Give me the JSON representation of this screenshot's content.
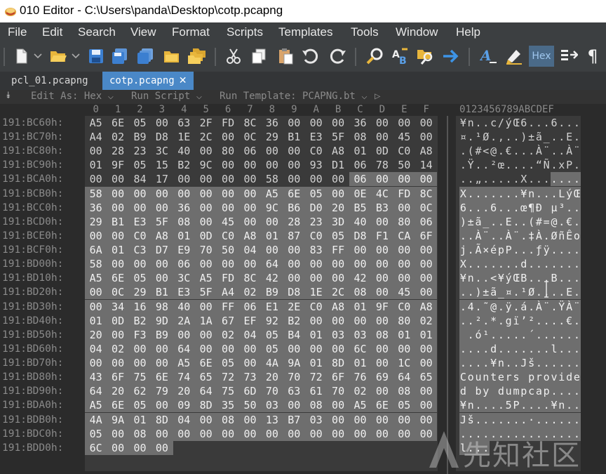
{
  "window": {
    "title": "010 Editor - C:\\Users\\panda\\Desktop\\cotp.pcapng"
  },
  "menu": [
    "File",
    "Edit",
    "Search",
    "View",
    "Format",
    "Scripts",
    "Templates",
    "Tools",
    "Window",
    "Help"
  ],
  "toolbar": {
    "icons": [
      "new-file-icon",
      "open-folder-icon",
      "save-icon",
      "save-as-icon",
      "save-all-icon",
      "close-folder-icon",
      "open-multiple-icon",
      "cut-icon",
      "copy-icon",
      "paste-icon",
      "undo-icon",
      "redo-icon",
      "find-icon",
      "replace-icon",
      "find-in-files-icon",
      "goto-icon",
      "font-icon",
      "highlight-icon",
      "hex-mode-icon",
      "compare-icon",
      "pilcrow-icon"
    ],
    "hex_label": "Hex",
    "pilcrow": "¶"
  },
  "tabs": [
    {
      "label": "pcl_01.pcapng",
      "active": false
    },
    {
      "label": "cotp.pcapng",
      "active": true,
      "close": "✕"
    }
  ],
  "editbar": {
    "edit_as": "Edit As: Hex ⌵",
    "run_script": "Run Script ⌵",
    "run_template": "Run Template: PCAPNG.bt ⌵",
    "play": "▷"
  },
  "hex": {
    "column_headers": [
      "0",
      "1",
      "2",
      "3",
      "4",
      "5",
      "6",
      "7",
      "8",
      "9",
      "A",
      "B",
      "C",
      "D",
      "E",
      "F"
    ],
    "ascii_header": "0123456789ABCDEF",
    "selection_color": "#6e6e6e",
    "rows": [
      {
        "addr": "191:BC60h:",
        "bytes": [
          "A5",
          "6E",
          "05",
          "00",
          "63",
          "2F",
          "FD",
          "8C",
          "36",
          "00",
          "00",
          "00",
          "36",
          "00",
          "00",
          "00"
        ],
        "ascii": "¥n..c/ýŒ6...6..."
      },
      {
        "addr": "191:BC70h:",
        "bytes": [
          "A4",
          "02",
          "B9",
          "D8",
          "1E",
          "2C",
          "00",
          "0C",
          "29",
          "B1",
          "E3",
          "5F",
          "08",
          "00",
          "45",
          "00"
        ],
        "ascii": "¤.¹Ø.,..)±ã_..E."
      },
      {
        "addr": "191:BC80h:",
        "bytes": [
          "00",
          "28",
          "23",
          "3C",
          "40",
          "00",
          "80",
          "06",
          "00",
          "00",
          "C0",
          "A8",
          "01",
          "0D",
          "C0",
          "A8"
        ],
        "ascii": ".(#<@.€...À¨..À¨"
      },
      {
        "addr": "191:BC90h:",
        "bytes": [
          "01",
          "9F",
          "05",
          "15",
          "B2",
          "9C",
          "00",
          "00",
          "00",
          "00",
          "93",
          "D1",
          "06",
          "78",
          "50",
          "14"
        ],
        "ascii": ".Ÿ..²œ....“Ñ.xP."
      },
      {
        "addr": "191:BCA0h:",
        "bytes": [
          "00",
          "00",
          "84",
          "17",
          "00",
          "00",
          "00",
          "00",
          "58",
          "00",
          "00",
          "00",
          "06",
          "00",
          "00",
          "00"
        ],
        "ascii": "..„.....X......."
      },
      {
        "addr": "191:BCB0h:",
        "bytes": [
          "58",
          "00",
          "00",
          "00",
          "00",
          "00",
          "00",
          "00",
          "A5",
          "6E",
          "05",
          "00",
          "0E",
          "4C",
          "FD",
          "8C"
        ],
        "ascii": "X.......¥n...LýŒ"
      },
      {
        "addr": "191:BCC0h:",
        "bytes": [
          "36",
          "00",
          "00",
          "00",
          "36",
          "00",
          "00",
          "00",
          "9C",
          "B6",
          "D0",
          "20",
          "B5",
          "B3",
          "00",
          "0C"
        ],
        "ascii": "6...6...œ¶Ð µ³.."
      },
      {
        "addr": "191:BCD0h:",
        "bytes": [
          "29",
          "B1",
          "E3",
          "5F",
          "08",
          "00",
          "45",
          "00",
          "00",
          "28",
          "23",
          "3D",
          "40",
          "00",
          "80",
          "06"
        ],
        "ascii": ")±ã_..E..(#=@.€."
      },
      {
        "addr": "191:BCE0h:",
        "bytes": [
          "00",
          "00",
          "C0",
          "A8",
          "01",
          "0D",
          "C0",
          "A8",
          "01",
          "87",
          "C0",
          "05",
          "D8",
          "F1",
          "CA",
          "6F"
        ],
        "ascii": "..À¨..À¨.‡À.ØñÊo"
      },
      {
        "addr": "191:BCF0h:",
        "bytes": [
          "6A",
          "01",
          "C3",
          "D7",
          "E9",
          "70",
          "50",
          "04",
          "00",
          "00",
          "83",
          "FF",
          "00",
          "00",
          "00",
          "00"
        ],
        "ascii": "j.Ã×épP...ƒÿ...."
      },
      {
        "addr": "191:BD00h:",
        "bytes": [
          "58",
          "00",
          "00",
          "00",
          "06",
          "00",
          "00",
          "00",
          "64",
          "00",
          "00",
          "00",
          "00",
          "00",
          "00",
          "00"
        ],
        "ascii": "X.......d......."
      },
      {
        "addr": "191:BD10h:",
        "bytes": [
          "A5",
          "6E",
          "05",
          "00",
          "3C",
          "A5",
          "FD",
          "8C",
          "42",
          "00",
          "00",
          "00",
          "42",
          "00",
          "00",
          "00"
        ],
        "ascii": "¥n..<¥ýŒB...B..."
      },
      {
        "addr": "191:BD20h:",
        "bytes": [
          "00",
          "0C",
          "29",
          "B1",
          "E3",
          "5F",
          "A4",
          "02",
          "B9",
          "D8",
          "1E",
          "2C",
          "08",
          "00",
          "45",
          "00"
        ],
        "ascii": "..)±ã_¤.¹Ø.,..E."
      },
      {
        "addr": "191:BD30h:",
        "bytes": [
          "00",
          "34",
          "16",
          "98",
          "40",
          "00",
          "FF",
          "06",
          "E1",
          "2E",
          "C0",
          "A8",
          "01",
          "9F",
          "C0",
          "A8"
        ],
        "ascii": ".4.˜@.ÿ.á.À¨.ŸÀ¨"
      },
      {
        "addr": "191:BD40h:",
        "bytes": [
          "01",
          "0D",
          "B2",
          "9D",
          "2A",
          "1A",
          "67",
          "EF",
          "92",
          "B2",
          "00",
          "00",
          "00",
          "00",
          "80",
          "02"
        ],
        "ascii": "..².*.gï’²....€."
      },
      {
        "addr": "191:BD50h:",
        "bytes": [
          "20",
          "00",
          "F3",
          "B9",
          "00",
          "00",
          "02",
          "04",
          "05",
          "B4",
          "01",
          "03",
          "03",
          "08",
          "01",
          "01"
        ],
        "ascii": " .ó¹.....´......"
      },
      {
        "addr": "191:BD60h:",
        "bytes": [
          "04",
          "02",
          "00",
          "00",
          "64",
          "00",
          "00",
          "00",
          "05",
          "00",
          "00",
          "00",
          "6C",
          "00",
          "00",
          "00"
        ],
        "ascii": "....d.......l..."
      },
      {
        "addr": "191:BD70h:",
        "bytes": [
          "00",
          "00",
          "00",
          "00",
          "A5",
          "6E",
          "05",
          "00",
          "4A",
          "9A",
          "01",
          "8D",
          "01",
          "00",
          "1C",
          "00"
        ],
        "ascii": "....¥n..Jš......"
      },
      {
        "addr": "191:BD80h:",
        "bytes": [
          "43",
          "6F",
          "75",
          "6E",
          "74",
          "65",
          "72",
          "73",
          "20",
          "70",
          "72",
          "6F",
          "76",
          "69",
          "64",
          "65"
        ],
        "ascii": "Counters provide"
      },
      {
        "addr": "191:BD90h:",
        "bytes": [
          "64",
          "20",
          "62",
          "79",
          "20",
          "64",
          "75",
          "6D",
          "70",
          "63",
          "61",
          "70",
          "02",
          "00",
          "08",
          "00"
        ],
        "ascii": "d by dumpcap...."
      },
      {
        "addr": "191:BDA0h:",
        "bytes": [
          "A5",
          "6E",
          "05",
          "00",
          "09",
          "8D",
          "35",
          "50",
          "03",
          "00",
          "08",
          "00",
          "A5",
          "6E",
          "05",
          "00"
        ],
        "ascii": "¥n....5P....¥n.."
      },
      {
        "addr": "191:BDB0h:",
        "bytes": [
          "4A",
          "9A",
          "01",
          "8D",
          "04",
          "00",
          "08",
          "00",
          "13",
          "B7",
          "03",
          "00",
          "00",
          "00",
          "00",
          "00"
        ],
        "ascii": "Jš.......·......"
      },
      {
        "addr": "191:BDC0h:",
        "bytes": [
          "05",
          "00",
          "08",
          "00",
          "00",
          "00",
          "00",
          "00",
          "00",
          "00",
          "00",
          "00",
          "00",
          "00",
          "00",
          "00"
        ],
        "ascii": "................"
      },
      {
        "addr": "191:BDD0h:",
        "bytes": [
          "6C",
          "00",
          "00",
          "00"
        ],
        "ascii": "l..."
      }
    ]
  },
  "watermark": {
    "text": "先知社区"
  }
}
